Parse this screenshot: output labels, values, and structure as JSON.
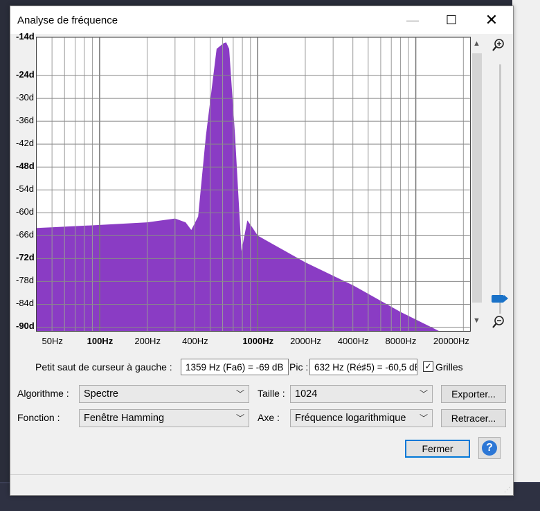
{
  "window": {
    "title": "Analyse de fréquence",
    "min": "—",
    "max": "☐",
    "close": "✕"
  },
  "y_ticks": [
    {
      "label": "-14d",
      "bold": true
    },
    {
      "label": "-24d",
      "bold": true
    },
    {
      "label": "-30d",
      "bold": false
    },
    {
      "label": "-36d",
      "bold": false
    },
    {
      "label": "-42d",
      "bold": false
    },
    {
      "label": "-48d",
      "bold": true
    },
    {
      "label": "-54d",
      "bold": false
    },
    {
      "label": "-60d",
      "bold": false
    },
    {
      "label": "-66d",
      "bold": false
    },
    {
      "label": "-72d",
      "bold": true
    },
    {
      "label": "-78d",
      "bold": false
    },
    {
      "label": "-84d",
      "bold": false
    },
    {
      "label": "-90d",
      "bold": true
    }
  ],
  "x_ticks": [
    "50Hz",
    "100Hz",
    "200Hz",
    "400Hz",
    "1000Hz",
    "2000Hz",
    "4000Hz",
    "8000Hz",
    "20000Hz"
  ],
  "chart_data": {
    "type": "area",
    "color": "#8a3cc4",
    "xscale": "log",
    "ylabel": "",
    "xlabel": "",
    "ylim": [
      -91,
      -14
    ],
    "xlim": [
      40,
      22050
    ],
    "x": [
      40,
      50,
      100,
      200,
      300,
      350,
      380,
      420,
      470,
      550,
      610,
      632,
      660,
      720,
      790,
      860,
      930,
      1000,
      2000,
      4000,
      8000,
      14000,
      20000,
      22050
    ],
    "y": [
      -64,
      -63.8,
      -63.2,
      -62.5,
      -61.5,
      -62.5,
      -64.5,
      -61,
      -40,
      -17,
      -15.5,
      -15.3,
      -17,
      -40,
      -70,
      -62,
      -64,
      -66,
      -73,
      -79,
      -86,
      -91,
      -91,
      -91
    ],
    "grid": true
  },
  "cursor": {
    "label": "Petit saut de curseur à gauche :",
    "value": "1359 Hz (Fa6) = -69 dB",
    "peak_label": "Pic :",
    "peak_value": "632 Hz (Ré♯5) = -60,5 dB",
    "grid_label": "Grilles",
    "grid_checked": "✓"
  },
  "controls": {
    "algo_label": "Algorithme :",
    "algo_value": "Spectre",
    "size_label": "Taille :",
    "size_value": "1024",
    "func_label": "Fonction :",
    "func_value": "Fenêtre Hamming",
    "axis_label": "Axe :",
    "axis_value": "Fréquence logarithmique",
    "export": "Exporter...",
    "redraw": "Retracer...",
    "close": "Fermer",
    "help": "?"
  }
}
